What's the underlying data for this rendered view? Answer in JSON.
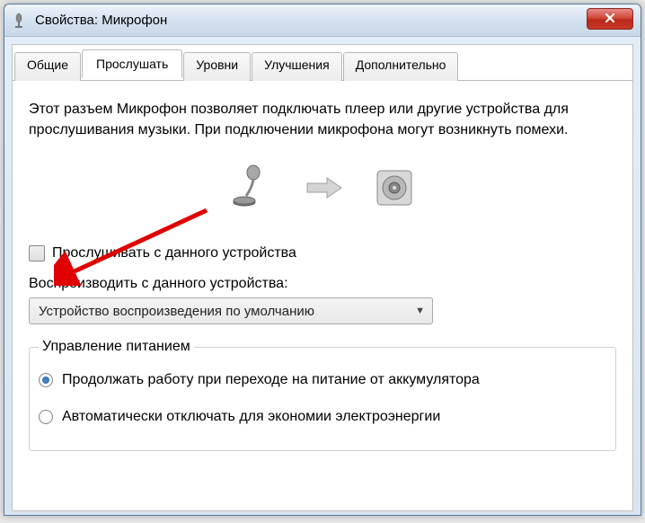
{
  "titlebar": {
    "title": "Свойства: Микрофон"
  },
  "tabs": {
    "general": "Общие",
    "listen": "Прослушать",
    "levels": "Уровни",
    "enhancements": "Улучшения",
    "advanced": "Дополнительно"
  },
  "listen_tab": {
    "description": "Этот разъем Микрофон позволяет подключать плеер или другие устройства для прослушивания музыки. При подключении микрофона могут возникнуть помехи.",
    "checkbox_listen": "Прослушивать с данного устройства",
    "playback_label": "Воспроизводить с данного устройства:",
    "dropdown_value": "Устройство воспроизведения по умолчанию",
    "power": {
      "legend": "Управление питанием",
      "opt_continue": "Продолжать работу при переходе на питание от аккумулятора",
      "opt_auto_off": "Автоматически отключать для экономии электроэнергии"
    }
  }
}
